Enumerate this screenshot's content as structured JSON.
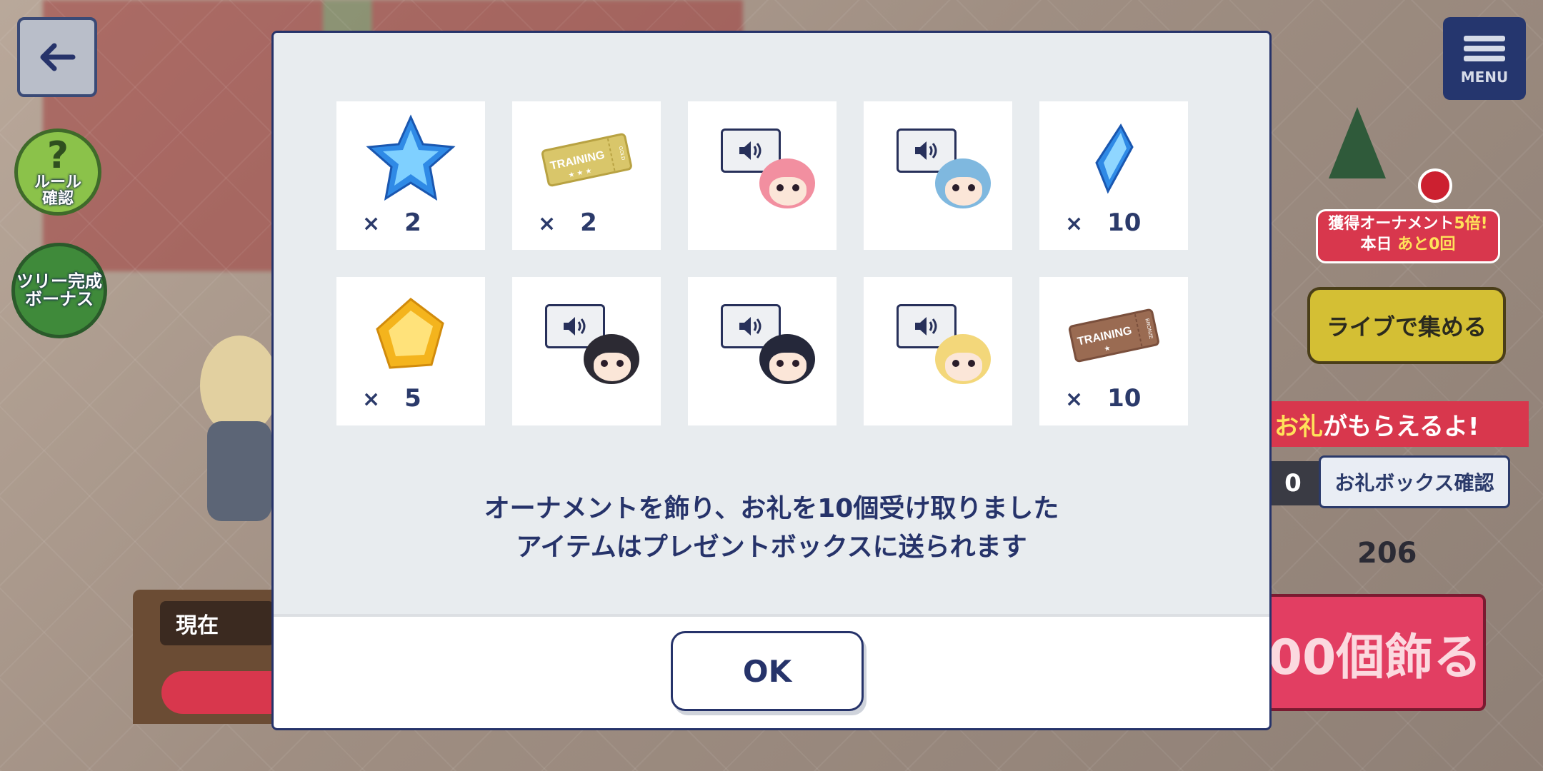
{
  "nav": {
    "menu_label": "MENU"
  },
  "side_buttons": {
    "rule_label": "ルール\n確認",
    "tree_bonus_label": "ツリー完成\nボーナス"
  },
  "event": {
    "bonus_tag_line1_a": "獲得オーナメント",
    "bonus_tag_line1_b": "5倍!",
    "bonus_tag_line2_a": "本日 ",
    "bonus_tag_line2_b": "あと0回",
    "live_button": "ライブで集める",
    "banner_hl": "お礼",
    "banner_rest": "がもらえるよ!",
    "count_strip": "0",
    "check_box_button": "お礼ボックス確認",
    "score": "206",
    "decorate_button": "00個飾る",
    "current_label": "現在"
  },
  "modal": {
    "items": [
      {
        "kind": "star-gem",
        "icon": "blue-star-icon",
        "qty": "2"
      },
      {
        "kind": "ticket-gold",
        "icon": "gold-training-ticket-icon",
        "ticket_text": "TRAINING",
        "ticket_sub": "★ ★ ★",
        "ticket_side": "GOLD",
        "qty": "2"
      },
      {
        "kind": "voice",
        "icon": "voice-pink-hair-icon",
        "hair": "#f28fa0"
      },
      {
        "kind": "voice",
        "icon": "voice-blue-hair-icon",
        "hair": "#7fb8df"
      },
      {
        "kind": "crystal",
        "icon": "blue-crystal-icon",
        "qty": "10"
      },
      {
        "kind": "yellow-gem",
        "icon": "yellow-gem-icon",
        "qty": "5"
      },
      {
        "kind": "voice",
        "icon": "voice-black-hair-icon",
        "hair": "#2c2a33"
      },
      {
        "kind": "voice",
        "icon": "voice-dark-hair-icon",
        "hair": "#25283a"
      },
      {
        "kind": "voice",
        "icon": "voice-blonde-hair-icon",
        "hair": "#f3d77a"
      },
      {
        "kind": "ticket-bronze",
        "icon": "bronze-training-ticket-icon",
        "ticket_text": "TRAINING",
        "ticket_sub": "★",
        "ticket_side": "BRONZE",
        "qty": "10"
      }
    ],
    "qty_prefix": "×",
    "message_line1": "オーナメントを飾り、お礼を10個受け取りました",
    "message_line2": "アイテムはプレゼントボックスに送られます",
    "ok_label": "OK"
  }
}
